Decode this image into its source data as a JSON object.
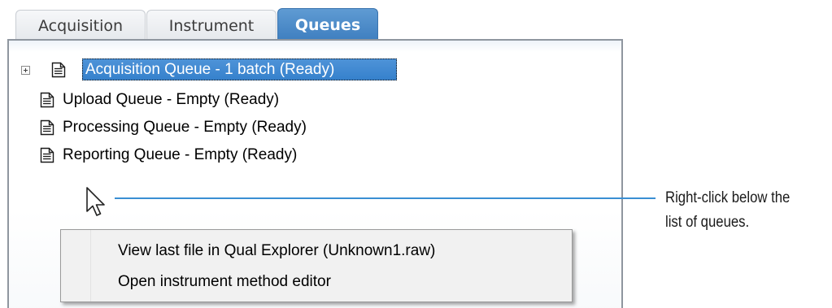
{
  "tabs": [
    {
      "label": "Acquisition",
      "active": false
    },
    {
      "label": "Instrument",
      "active": false
    },
    {
      "label": "Queues",
      "active": true
    }
  ],
  "queues": [
    {
      "label": "Acquisition Queue - 1 batch (Ready)",
      "selected": true,
      "expandable": true
    },
    {
      "label": "Upload Queue - Empty (Ready)",
      "selected": false,
      "expandable": false
    },
    {
      "label": "Processing Queue - Empty (Ready)",
      "selected": false,
      "expandable": false
    },
    {
      "label": "Reporting Queue - Empty (Ready)",
      "selected": false,
      "expandable": false
    }
  ],
  "context_menu": {
    "items": [
      {
        "label": "View last file in Qual Explorer (Unknown1.raw)"
      },
      {
        "label": "Open instrument method editor"
      }
    ]
  },
  "callout": {
    "line1": "Right-click below the",
    "line2": "list of queues."
  },
  "colors": {
    "active_tab": "#4a8ac9",
    "selection": "#3b86d0",
    "callout_line": "#3a8fd3"
  },
  "icons": {
    "expander": "plus-box-icon",
    "queue_item": "document-icon",
    "pointer": "mouse-pointer-icon"
  }
}
